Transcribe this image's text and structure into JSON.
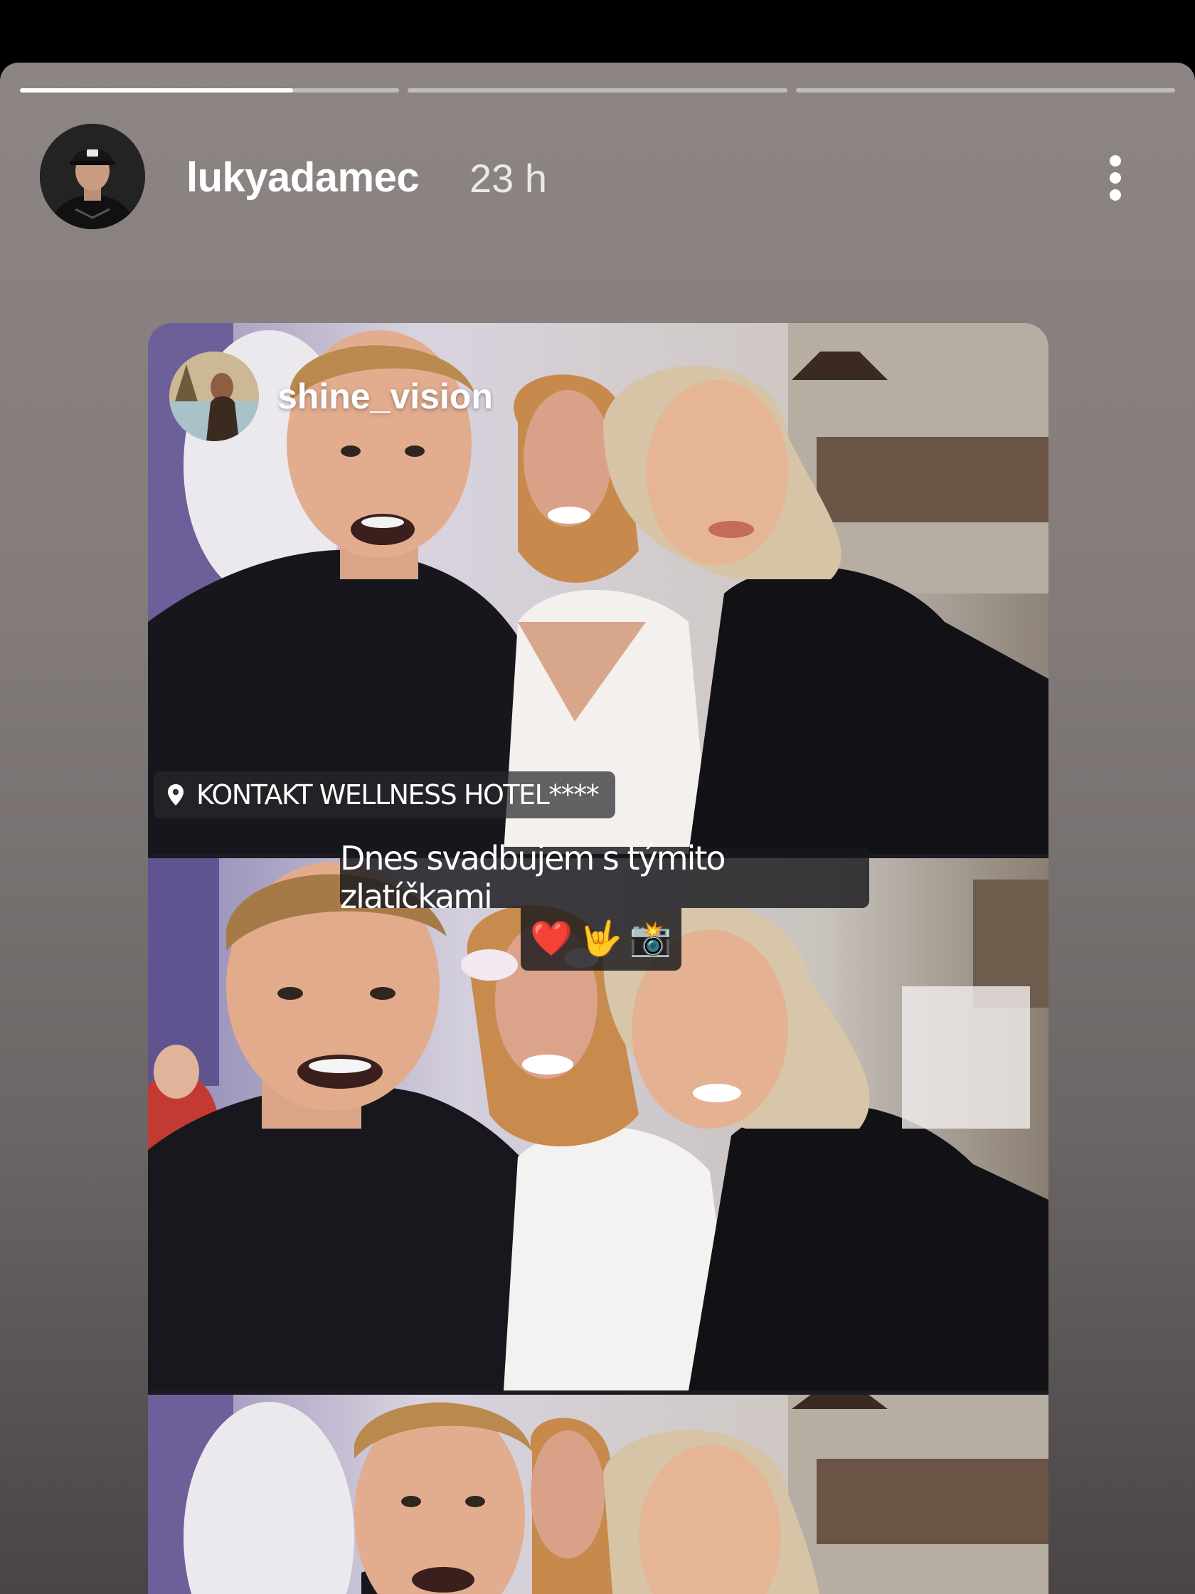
{
  "story": {
    "username": "lukyadamec",
    "timestamp": "23 h",
    "progress": [
      0.72,
      0,
      0
    ]
  },
  "repost": {
    "username": "shine_vision"
  },
  "sticker": {
    "location": "KONTAKT WELLNESS HOTEL****",
    "caption": "Dnes svadbujem s týmito zlatíčkami",
    "emojis": [
      "❤️",
      "🤟",
      "📸"
    ]
  },
  "colors": {
    "background": "#8d8583",
    "progress_fill": "#ffffff",
    "progress_track": "#ffffffa0"
  }
}
